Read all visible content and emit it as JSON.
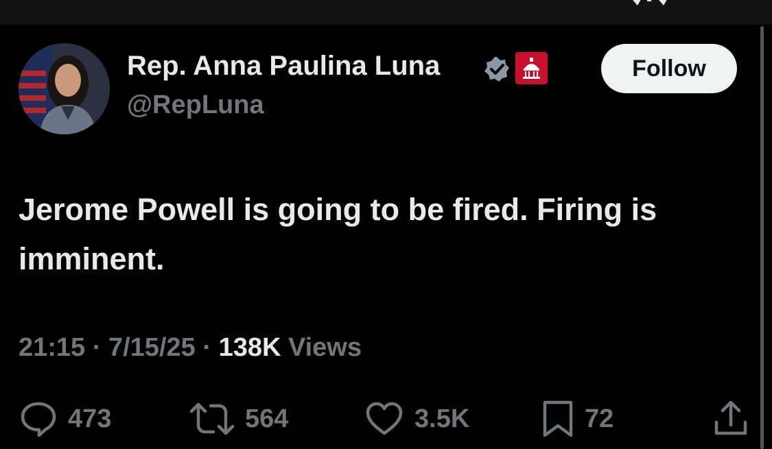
{
  "header": {
    "display_name": "Rep. Anna Paulina Luna",
    "handle": "@RepLuna",
    "follow_label": "Follow"
  },
  "icons": {
    "verified": "verified-badge-icon",
    "affiliation": "house-gop-capitol-badge-icon"
  },
  "tweet": {
    "text": "Jerome Powell is going to be fired. Firing is imminent."
  },
  "meta": {
    "time": "21:15",
    "separator": "·",
    "date": "7/15/25",
    "views_count": "138K",
    "views_label": "Views"
  },
  "actions": {
    "replies": "473",
    "reposts": "564",
    "likes": "3.5K",
    "bookmarks": "72"
  },
  "colors": {
    "background": "#000000",
    "primary_text": "#e7e9ea",
    "secondary_text": "#71767b",
    "follow_bg": "#eff3f4",
    "badge_red": "#c8102e"
  }
}
